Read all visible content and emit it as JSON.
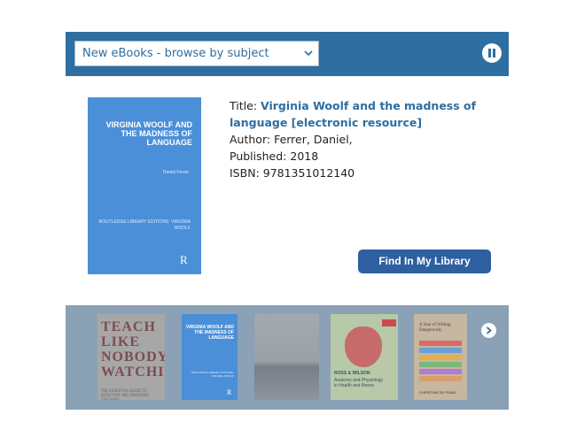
{
  "widget": {
    "select": {
      "selected": "New eBooks - browse by subject"
    },
    "controls": {
      "pause_icon": "pause-icon",
      "next_icon": "chevron-right-icon"
    },
    "featured": {
      "cover": {
        "title": "VIRGINIA WOOLF AND THE MADNESS OF LANGUAGE",
        "author": "Daniel Ferrer",
        "series": "ROUTLEDGE LIBRARY EDITIONS: VIRGINIA WOOLF",
        "logo": "R"
      },
      "title_label": "Title:",
      "title_value": "Virginia Woolf and the madness of language [electronic resource]",
      "author_label": "Author:",
      "author_value": "Ferrer, Daniel,",
      "published_label": "Published:",
      "published_value": "2018",
      "isbn_label": "ISBN:",
      "isbn_value": "9781351012140",
      "button_label": "Find In My Library"
    },
    "carousel": [
      {
        "text": "TEACH LIKE NOBODY'S WATCHING",
        "subtitle": "THE ESSENTIAL GUIDE TO EFFECTIVE AND ENGAGING TEACHING"
      },
      {
        "text": "VIRGINIA WOOLF AND THE MADNESS OF LANGUAGE",
        "series": "ROUTLEDGE LIBRARY EDITIONS: VIRGINIA WOOLF",
        "logo": "R"
      },
      {
        "text": ""
      },
      {
        "text": "ROSS & WILSON",
        "subtitle": "Anatomy and Physiology in Health and Illness"
      },
      {
        "text": "A Year of Writing Dangerously",
        "subtitle": "CHRISTINE DE PIZAN"
      }
    ],
    "colors": {
      "bar": "#2e6ea1",
      "button": "#2e5fa0",
      "carousel_bg": "#8aa1b6",
      "link": "#2e6ea1"
    }
  }
}
